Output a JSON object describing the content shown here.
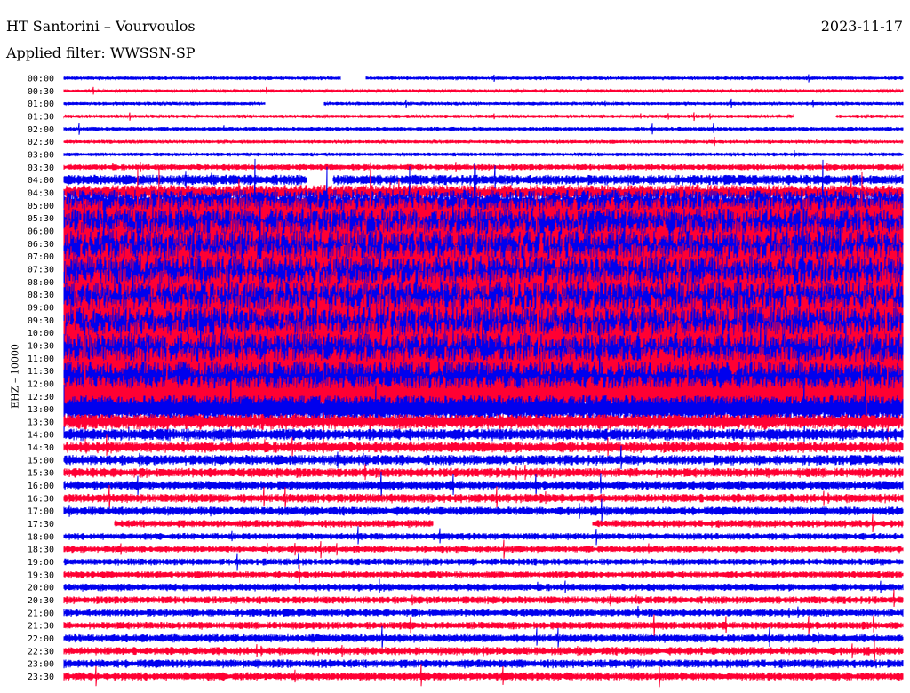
{
  "header": {
    "station": "HT Santorini – Vourvoulos",
    "date": "2023-11-17",
    "filter": "Applied filter: WWSSN-SP"
  },
  "chart_data": {
    "type": "line",
    "ylabel": "EHZ – 10000",
    "row_labels": [
      "00:00",
      "00:30",
      "01:00",
      "01:30",
      "02:00",
      "02:30",
      "03:00",
      "03:30",
      "04:00",
      "04:30",
      "05:00",
      "05:30",
      "06:00",
      "06:30",
      "07:00",
      "07:30",
      "08:00",
      "08:30",
      "09:00",
      "09:30",
      "10:00",
      "10:30",
      "11:00",
      "11:30",
      "12:00",
      "12:30",
      "13:00",
      "13:30",
      "14:00",
      "14:30",
      "15:00",
      "15:30",
      "16:00",
      "16:30",
      "17:00",
      "17:30",
      "18:00",
      "18:30",
      "19:00",
      "19:30",
      "20:00",
      "20:30",
      "21:00",
      "21:30",
      "22:00",
      "22:30",
      "23:00",
      "23:30"
    ],
    "colors": {
      "even": "#0000ee",
      "odd": "#ff0033"
    },
    "amplitude_level": [
      0.1,
      0.09,
      0.1,
      0.1,
      0.12,
      0.1,
      0.11,
      0.18,
      0.3,
      0.45,
      0.9,
      1.2,
      1.3,
      1.4,
      1.5,
      1.5,
      1.5,
      1.5,
      1.5,
      1.5,
      1.5,
      1.5,
      1.45,
      1.4,
      1.3,
      1.2,
      0.8,
      0.45,
      0.35,
      0.32,
      0.3,
      0.28,
      0.27,
      0.26,
      0.25,
      0.22,
      0.2,
      0.2,
      0.2,
      0.2,
      0.22,
      0.22,
      0.22,
      0.22,
      0.24,
      0.24,
      0.25,
      0.25
    ],
    "gaps": [
      {
        "row": 0,
        "from": 0.33,
        "to": 0.36
      },
      {
        "row": 2,
        "from": 0.24,
        "to": 0.31
      },
      {
        "row": 3,
        "from": 0.87,
        "to": 0.92
      },
      {
        "row": 8,
        "from": 0.29,
        "to": 0.32
      },
      {
        "row": 35,
        "from": 0.0,
        "to": 0.06
      },
      {
        "row": 35,
        "from": 0.44,
        "to": 0.63
      }
    ]
  }
}
